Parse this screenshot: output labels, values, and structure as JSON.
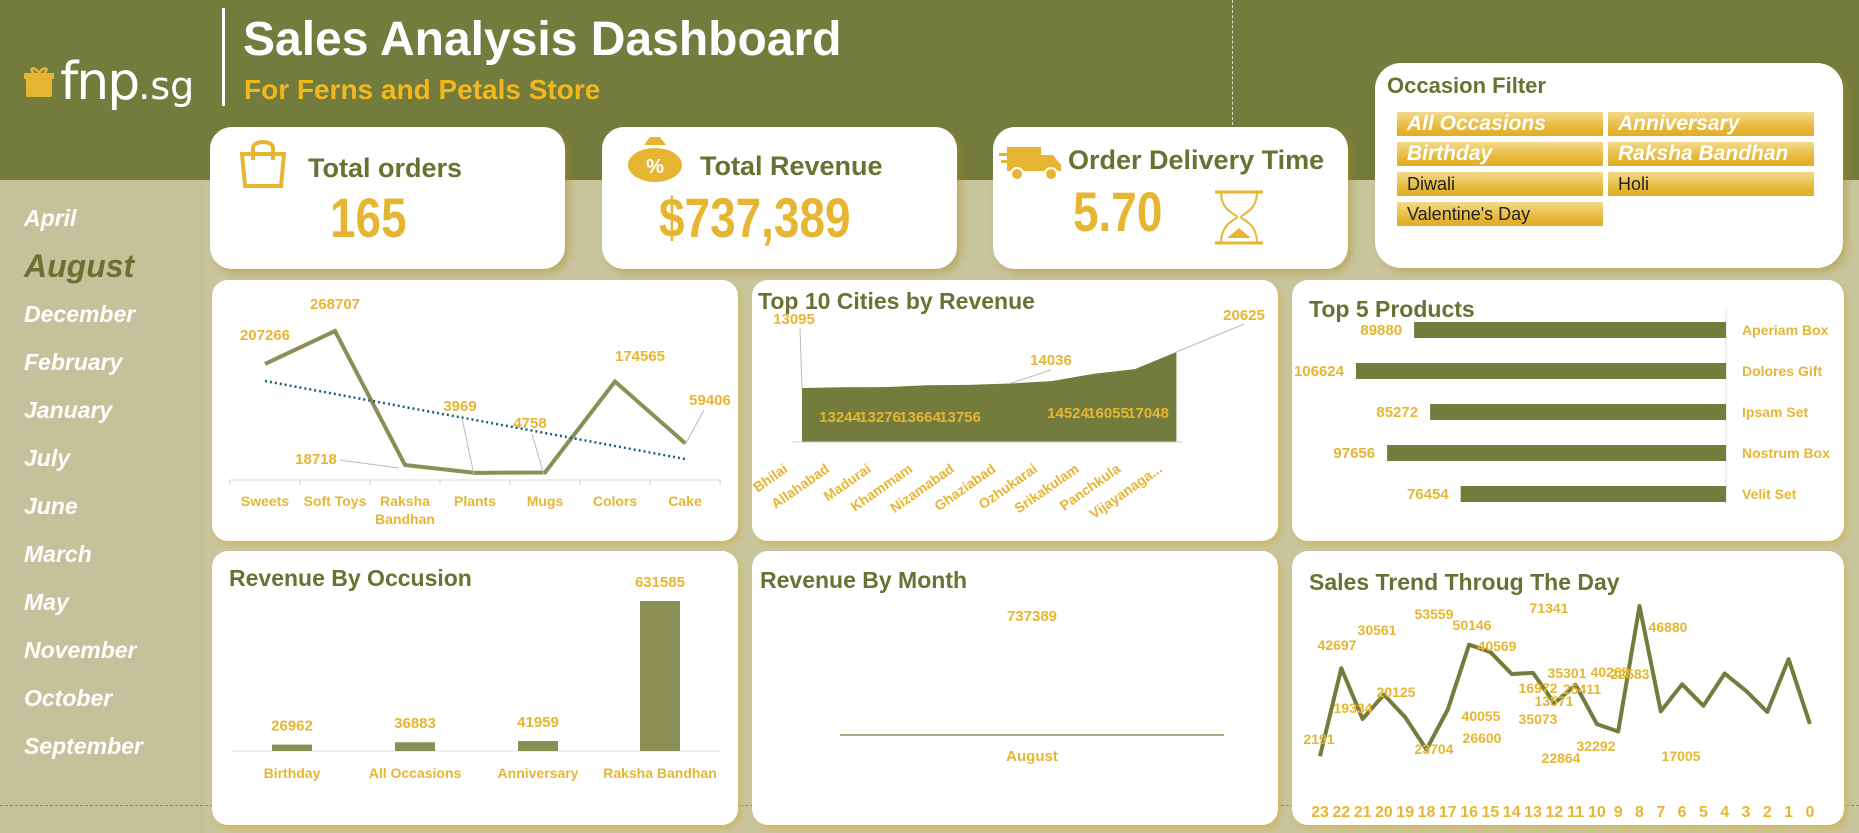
{
  "header": {
    "logo_text": "fnp",
    "logo_suffix": ".sg",
    "title": "Sales Analysis Dashboard",
    "subtitle": "For Ferns and Petals Store"
  },
  "colors": {
    "olive": "#737c3c",
    "gold": "#e6b632",
    "sand": "#c9c59c",
    "bar": "#8a8f55"
  },
  "kpis": {
    "orders": {
      "label": "Total orders",
      "value": "165",
      "icon": "shopping-bag-icon"
    },
    "revenue": {
      "label": "Total Revenue",
      "value": "$737,389",
      "icon": "money-bag-icon"
    },
    "delivery": {
      "label": "Order Delivery Time",
      "value": "5.70",
      "icon": "delivery-truck-icon",
      "icon2": "hourglass-icon"
    }
  },
  "filter": {
    "title": "Occasion Filter",
    "options": [
      "All Occasions",
      "Anniversary",
      "Birthday",
      "Raksha Bandhan",
      "Diwali",
      "Holi",
      "Valentine's Day"
    ]
  },
  "months": [
    "April",
    "August",
    "December",
    "February",
    "January",
    "July",
    "June",
    "March",
    "May",
    "November",
    "October",
    "September"
  ],
  "selected_month": "August",
  "chart_data": [
    {
      "id": "category",
      "type": "line",
      "title": "",
      "categories": [
        "Sweets",
        "Soft Toys",
        "Raksha Bandhan",
        "Plants",
        "Mugs",
        "Colors",
        "Cake"
      ],
      "values": [
        207266,
        268707,
        18718,
        3969,
        4758,
        174565,
        59406
      ],
      "labels": [
        "207266",
        "268707",
        "18718",
        "3969",
        "4758",
        "174565",
        "59406"
      ],
      "trendline": true
    },
    {
      "id": "cities",
      "type": "area",
      "title": "Top 10 Cities by Revenue",
      "categories": [
        "Bhilai",
        "Allahabad",
        "Madurai",
        "Khammam",
        "Nizamabad",
        "Ghaziabad",
        "Ozhukarai",
        "Srikakulam",
        "Panchkula",
        "Vijayanaga..."
      ],
      "values": [
        13095,
        13244,
        13276,
        13664,
        13756,
        14036,
        14524,
        16055,
        17048,
        20625
      ],
      "labels": [
        "13095",
        "13244",
        "13276",
        "13664",
        "13756",
        "14036",
        "14524",
        "16055",
        "17048",
        "20625"
      ]
    },
    {
      "id": "products",
      "type": "bar",
      "title": "Top 5 Products",
      "categories": [
        "Aperiam Box",
        "Dolores Gift",
        "Ipsam Set",
        "Nostrum Box",
        "Velit Set"
      ],
      "values": [
        89880,
        106624,
        85272,
        97656,
        76454
      ],
      "labels": [
        "89880",
        "106624",
        "85272",
        "97656",
        "76454"
      ]
    },
    {
      "id": "occasion",
      "type": "bar",
      "title": "Revenue By Occusion",
      "categories": [
        "Birthday",
        "All Occasions",
        "Anniversary",
        "Raksha Bandhan"
      ],
      "values": [
        26962,
        36883,
        41959,
        631585
      ],
      "labels": [
        "26962",
        "36883",
        "41959",
        "631585"
      ]
    },
    {
      "id": "month",
      "type": "line",
      "title": "Revenue By Month",
      "categories": [
        "August"
      ],
      "values": [
        737389
      ],
      "labels": [
        "737389"
      ]
    },
    {
      "id": "hourly",
      "type": "line",
      "title": "Sales Trend Throug The Day",
      "categories": [
        "23",
        "22",
        "21",
        "20",
        "19",
        "18",
        "17",
        "16",
        "15",
        "14",
        "13",
        "12",
        "11",
        "10",
        "9",
        "8",
        "7",
        "6",
        "5",
        "4",
        "3",
        "2",
        "1",
        "0"
      ],
      "values": [
        2191,
        42697,
        19334,
        30561,
        20125,
        5312,
        23704,
        53559,
        50146,
        40055,
        40569,
        26600,
        35073,
        16972,
        13571,
        71341,
        22864,
        35301,
        25411,
        40265,
        32292,
        22583,
        46880,
        17005
      ],
      "labels": [
        "2191",
        "42697",
        "19334",
        "30561",
        "20125",
        "",
        "23704",
        "53559",
        "50146",
        "40055",
        "40569",
        "26600",
        "35073",
        "16972",
        "13571",
        "71341",
        "22864",
        "35301",
        "25411",
        "40265",
        "32292",
        "22583",
        "46880",
        "17005"
      ]
    }
  ]
}
